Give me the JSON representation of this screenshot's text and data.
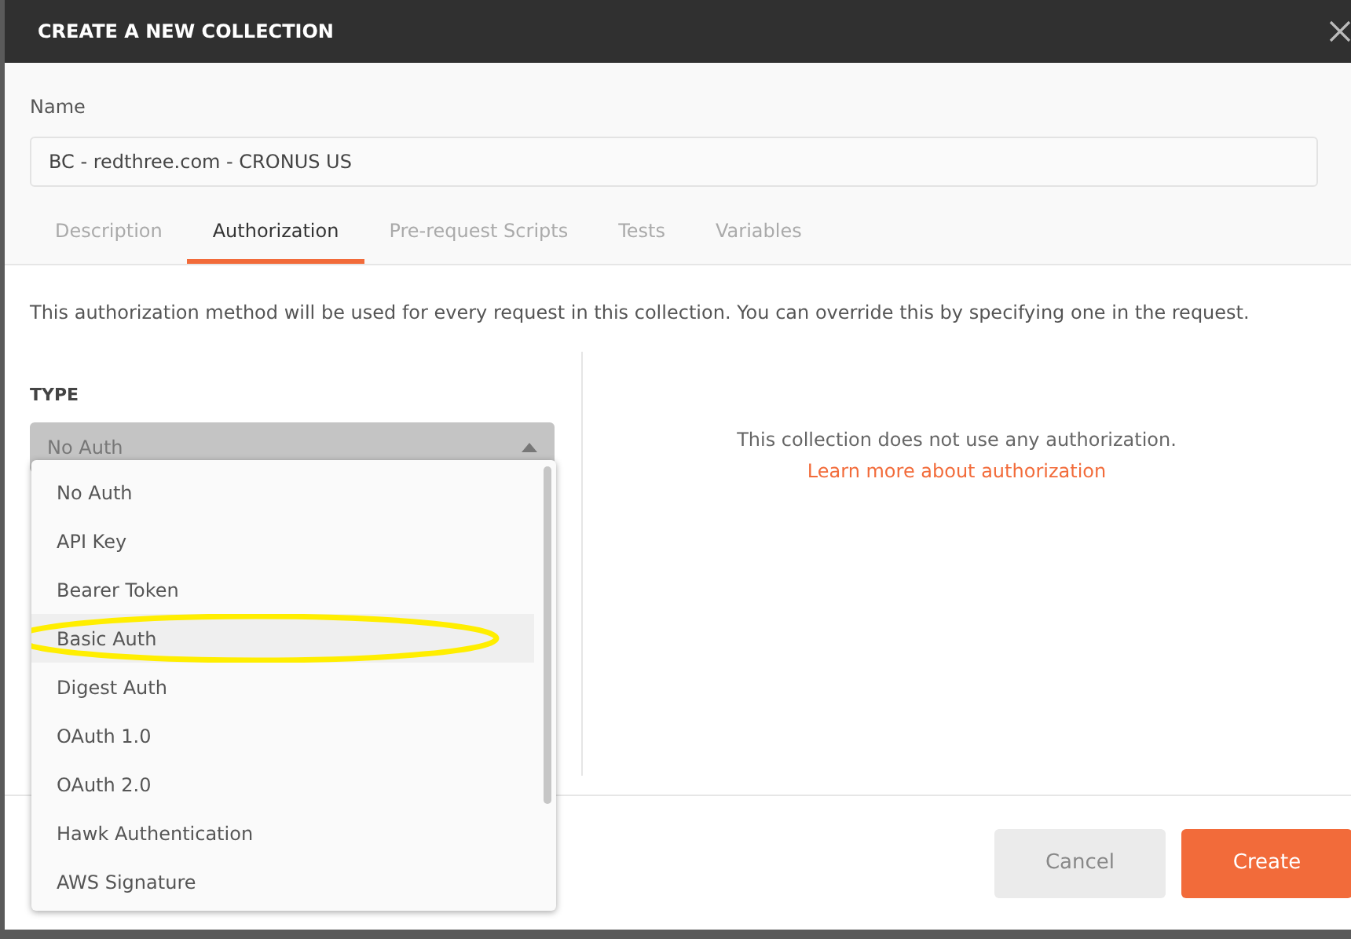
{
  "window": {
    "title": "CREATE A NEW COLLECTION"
  },
  "name_field": {
    "label": "Name",
    "value": "BC - redthree.com - CRONUS US"
  },
  "tabs": [
    {
      "label": "Description",
      "selected": false
    },
    {
      "label": "Authorization",
      "selected": true
    },
    {
      "label": "Pre-request Scripts",
      "selected": false
    },
    {
      "label": "Tests",
      "selected": false
    },
    {
      "label": "Variables",
      "selected": false
    }
  ],
  "intro": "This authorization method will be used for every request in this collection. You can override this by specifying one in the request.",
  "type_select": {
    "label": "TYPE",
    "value": "No Auth",
    "expanded": true
  },
  "type_options": [
    {
      "label": "No Auth",
      "highlighted": false,
      "circled": false
    },
    {
      "label": "API Key",
      "highlighted": false,
      "circled": false
    },
    {
      "label": "Bearer Token",
      "highlighted": false,
      "circled": false
    },
    {
      "label": "Basic Auth",
      "highlighted": true,
      "circled": true
    },
    {
      "label": "Digest Auth",
      "highlighted": false,
      "circled": false
    },
    {
      "label": "OAuth 1.0",
      "highlighted": false,
      "circled": false
    },
    {
      "label": "OAuth 2.0",
      "highlighted": false,
      "circled": false
    },
    {
      "label": "Hawk Authentication",
      "highlighted": false,
      "circled": false
    },
    {
      "label": "AWS Signature",
      "highlighted": false,
      "circled": false
    }
  ],
  "info": {
    "text": "This collection does not use any authorization.",
    "link": "Learn more about authorization"
  },
  "buttons": [
    {
      "label": "Cancel",
      "kind": "secondary"
    },
    {
      "label": "Create",
      "kind": "primary"
    }
  ]
}
